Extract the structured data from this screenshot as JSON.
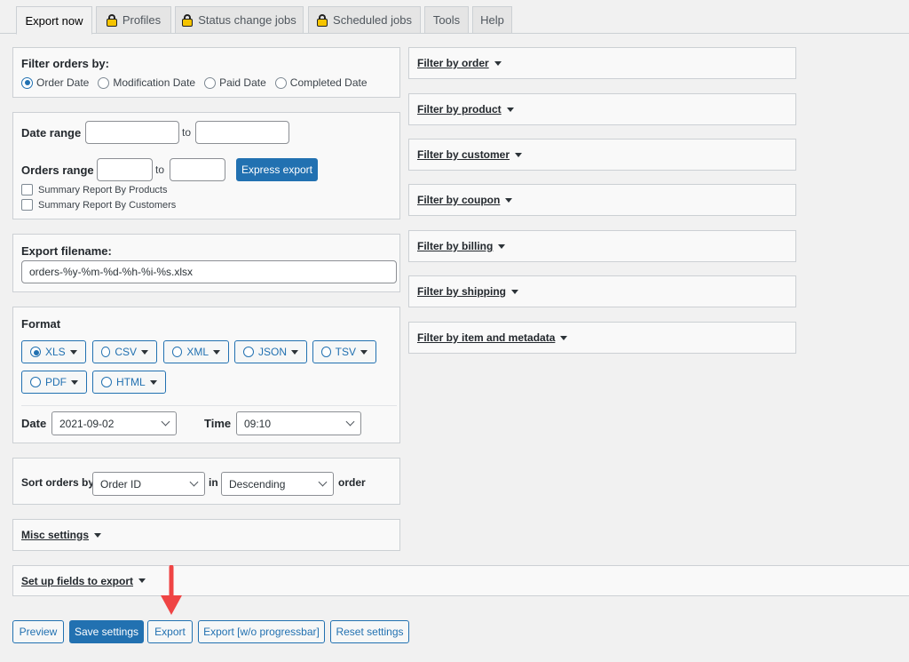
{
  "tabs": [
    {
      "label": "Export now",
      "active": true,
      "locked": false
    },
    {
      "label": "Profiles",
      "active": false,
      "locked": true
    },
    {
      "label": "Status change jobs",
      "active": false,
      "locked": true
    },
    {
      "label": "Scheduled jobs",
      "active": false,
      "locked": true
    },
    {
      "label": "Tools",
      "active": false,
      "locked": false
    },
    {
      "label": "Help",
      "active": false,
      "locked": false
    }
  ],
  "filter_orders": {
    "title": "Filter orders by:",
    "options": [
      "Order Date",
      "Modification Date",
      "Paid Date",
      "Completed Date"
    ],
    "selected": "Order Date"
  },
  "ranges": {
    "date_range_label": "Date range",
    "to1": "to",
    "orders_range_label": "Orders range",
    "to2": "to",
    "express_export": "Express export",
    "summary_products": "Summary Report By Products",
    "summary_customers": "Summary Report By Customers"
  },
  "filename": {
    "label": "Export filename:",
    "value": "orders-%y-%m-%d-%h-%i-%s.xlsx"
  },
  "format": {
    "title": "Format",
    "options": [
      "XLS",
      "CSV",
      "XML",
      "JSON",
      "TSV",
      "PDF",
      "HTML"
    ],
    "selected": "XLS",
    "date_label": "Date",
    "date_value": "2021-09-02",
    "time_label": "Time",
    "time_value": "09:10"
  },
  "sort": {
    "label": "Sort orders by",
    "field": "Order ID",
    "in": "in",
    "direction": "Descending",
    "order": "order"
  },
  "misc": "Misc settings",
  "fields": "Set up fields to export",
  "filters": [
    "Filter by order",
    "Filter by product",
    "Filter by customer",
    "Filter by coupon",
    "Filter by billing",
    "Filter by shipping",
    "Filter by item and metadata"
  ],
  "buttons": {
    "preview": "Preview",
    "save": "Save settings",
    "export": "Export",
    "export_no_progress": "Export [w/o progressbar]",
    "reset": "Reset settings"
  },
  "colors": {
    "accent": "#2271b1",
    "arrow": "#ef4444"
  }
}
